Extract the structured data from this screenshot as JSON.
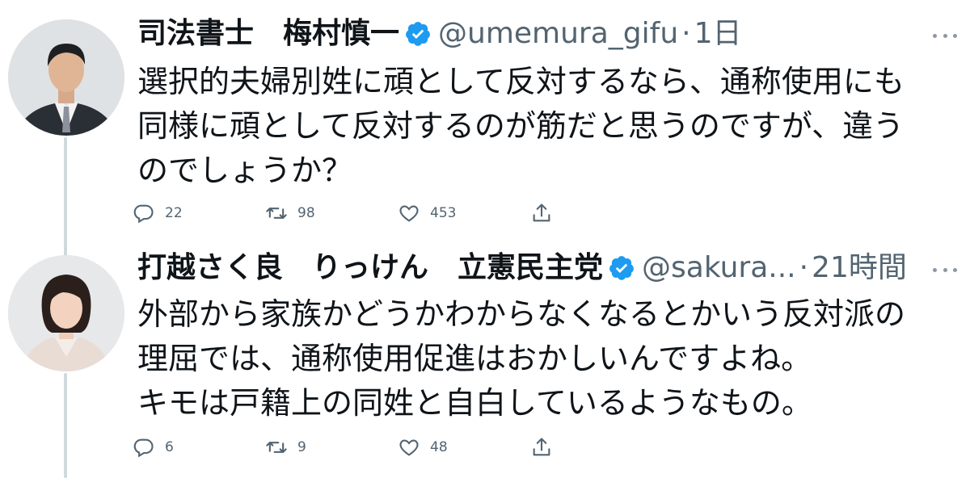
{
  "tweets": [
    {
      "name": "司法書士　梅村慎一",
      "handle": "@umemura_gifu",
      "separator": "·",
      "time": "1日",
      "lines": [
        "選択的夫婦別姓に頑として反対するなら、通称使用にも",
        "同様に頑として反対するのが筋だと思うのですが、違う",
        "のでしょうか？"
      ],
      "replies": "22",
      "retweets": "98",
      "likes": "453"
    },
    {
      "name": "打越さく良　りっけん　立憲民主党",
      "handle": "@sakura...",
      "separator": "·",
      "time": "21時間",
      "lines": [
        "外部から家族かどうかわからなくなるとかいう反対派の",
        "理屈では、通称使用促進はおかしいんですよね。",
        "キモは戸籍上の同姓と自白しているようなもの。"
      ],
      "replies": "6",
      "retweets": "9",
      "likes": "48"
    }
  ],
  "colors": {
    "verified": "#1d9bf0",
    "secondary_text": "#536471",
    "thread_line": "#cfd9de"
  },
  "icons": [
    "verified-badge-icon",
    "more-icon",
    "reply-icon",
    "retweet-icon",
    "like-icon",
    "share-icon"
  ]
}
